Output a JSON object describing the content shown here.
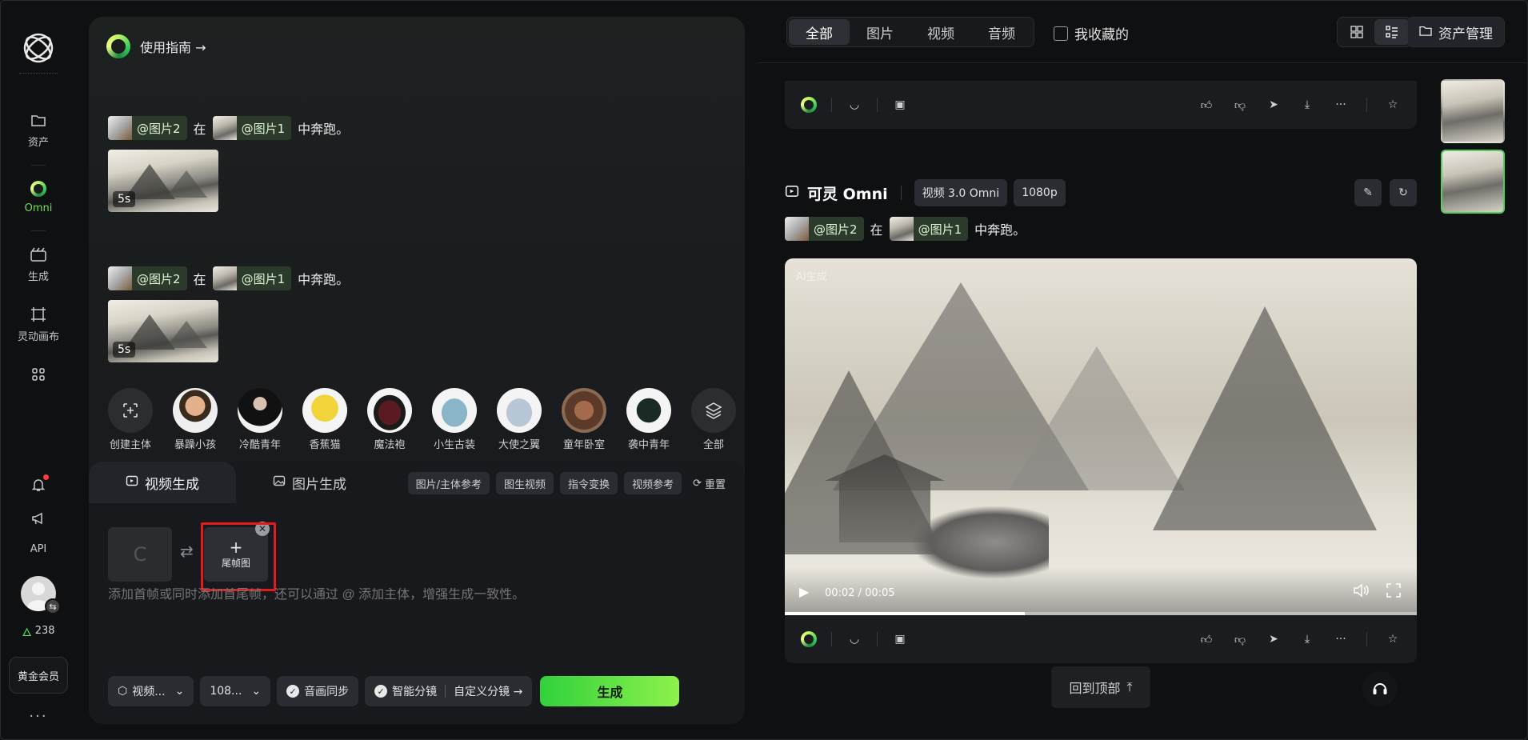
{
  "sidebar": {
    "items": [
      {
        "label": "资产",
        "icon": "folder-icon"
      },
      {
        "label": "Omni",
        "icon": "omni-icon"
      },
      {
        "label": "生成",
        "icon": "clapper-icon"
      },
      {
        "label": "灵动画布",
        "icon": "canvas-icon"
      },
      {
        "label": "",
        "icon": "grid-icon"
      }
    ],
    "api_label": "API",
    "credits": "238",
    "vip_label": "黄金会员",
    "more": "···"
  },
  "panel": {
    "guide_label": "使用指南 →",
    "history": [
      {
        "chip1": "@图片2",
        "mid": "在",
        "chip2": "@图片1",
        "tail": "中奔跑。",
        "duration": "5s"
      },
      {
        "chip1": "@图片2",
        "mid": "在",
        "chip2": "@图片1",
        "tail": "中奔跑。",
        "duration": "5s"
      }
    ],
    "subjects": [
      {
        "name": "创建主体",
        "kind": "create"
      },
      {
        "name": "暴躁小孩",
        "kind": "face"
      },
      {
        "name": "冷酷青年",
        "kind": "face"
      },
      {
        "name": "香蕉猫",
        "kind": "cat"
      },
      {
        "name": "魔法袍",
        "kind": "robe"
      },
      {
        "name": "小生古装",
        "kind": "robe"
      },
      {
        "name": "大使之翼",
        "kind": "wings"
      },
      {
        "name": "童年卧室",
        "kind": "room"
      },
      {
        "name": "袭中青年",
        "kind": "face"
      },
      {
        "name": "全部",
        "kind": "layers"
      }
    ]
  },
  "gen": {
    "tab_video": "视频生成",
    "tab_image": "图片生成",
    "modes": [
      "图片/主体参考",
      "图生视频",
      "指令变换",
      "视频参考"
    ],
    "reset": "重置",
    "first_frame_placeholder": "C",
    "last_frame_plus": "+",
    "last_frame_label": "尾帧图",
    "hint": "添加首帧或同时添加首尾帧，还可以通过 @ 添加主体，增强生成一致性。",
    "model_select": "视频...",
    "resolution_select": "108...",
    "audio_sync": "音画同步",
    "smart_shot": "智能分镜",
    "custom_shot": "自定义分镜 →",
    "generate": "生成"
  },
  "topbar": {
    "tabs": [
      "全部",
      "图片",
      "视频",
      "音频"
    ],
    "active_tab": 0,
    "favorites": "我收藏的",
    "asset_manage": "资产管理"
  },
  "result": {
    "title": "可灵 Omni",
    "tags": [
      "视频 3.0 Omni",
      "1080p"
    ],
    "chip1": "@图片2",
    "mid": "在",
    "chip2": "@图片1",
    "tail": "中奔跑。",
    "watermark": "AI生成",
    "time": "00:02 / 00:05",
    "progress": 0.38
  },
  "back_to_top": "回到顶部",
  "colors": {
    "accent": "#52d15a",
    "generate_from": "#31d13c",
    "generate_to": "#8df24c",
    "highlight": "#e31b1b"
  }
}
